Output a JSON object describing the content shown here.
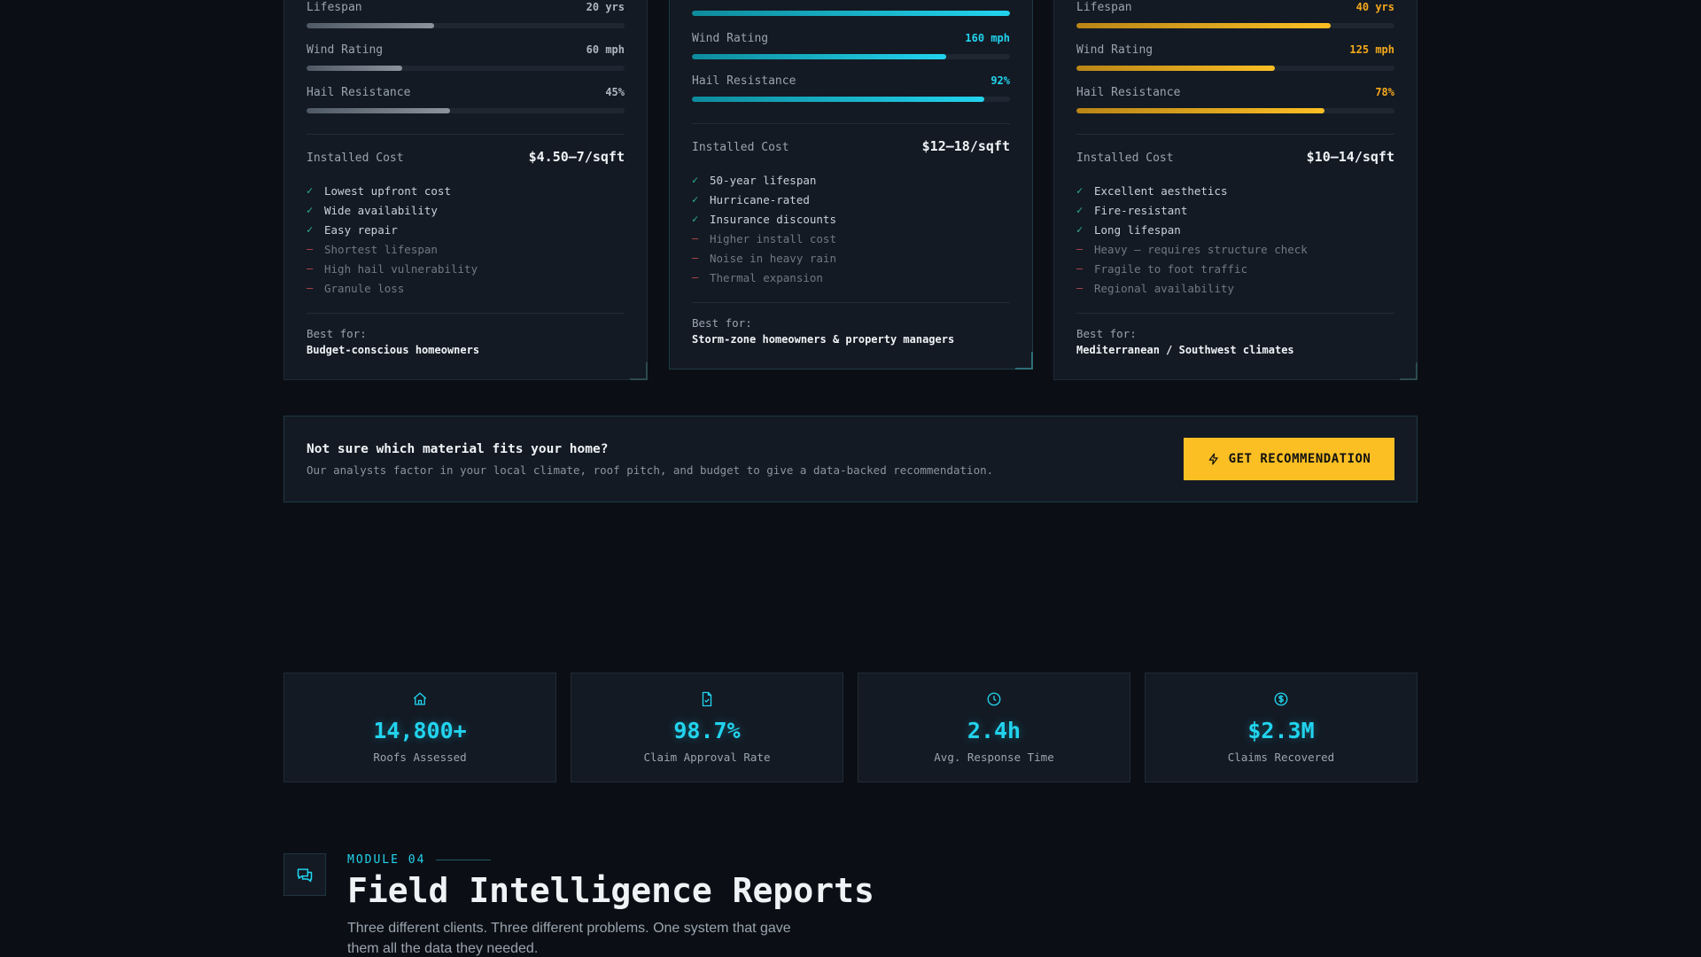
{
  "cards": [
    {
      "metrics": [
        {
          "label": "Lifespan",
          "value": "20 yrs",
          "fill": 0.4
        },
        {
          "label": "Wind Rating",
          "value": "60 mph",
          "fill": 0.3
        },
        {
          "label": "Hail Resistance",
          "value": "45%",
          "fill": 0.45
        }
      ],
      "cost_label": "Installed Cost",
      "cost_value": "$4.50–7/sqft",
      "features": [
        {
          "text": "Lowest upfront cost",
          "type": "pro"
        },
        {
          "text": "Wide availability",
          "type": "pro"
        },
        {
          "text": "Easy repair",
          "type": "pro"
        },
        {
          "text": "Shortest lifespan",
          "type": "con"
        },
        {
          "text": "High hail vulnerability",
          "type": "con"
        },
        {
          "text": "Granule loss",
          "type": "con"
        }
      ],
      "best_for_label": "Best for:",
      "best_for_value": "Budget-conscious homeowners"
    },
    {
      "metrics": [
        {
          "label": "",
          "value": "",
          "fill": 1.0
        },
        {
          "label": "Wind Rating",
          "value": "160 mph",
          "fill": 0.8
        },
        {
          "label": "Hail Resistance",
          "value": "92%",
          "fill": 0.92
        }
      ],
      "cost_label": "Installed Cost",
      "cost_value": "$12–18/sqft",
      "features": [
        {
          "text": "50-year lifespan",
          "type": "pro"
        },
        {
          "text": "Hurricane-rated",
          "type": "pro"
        },
        {
          "text": "Insurance discounts",
          "type": "pro"
        },
        {
          "text": "Higher install cost",
          "type": "con"
        },
        {
          "text": "Noise in heavy rain",
          "type": "con"
        },
        {
          "text": "Thermal expansion",
          "type": "con"
        }
      ],
      "best_for_label": "Best for:",
      "best_for_value": "Storm-zone homeowners & property managers"
    },
    {
      "metrics": [
        {
          "label": "Lifespan",
          "value": "40 yrs",
          "fill": 0.8
        },
        {
          "label": "Wind Rating",
          "value": "125 mph",
          "fill": 0.625
        },
        {
          "label": "Hail Resistance",
          "value": "78%",
          "fill": 0.78
        }
      ],
      "cost_label": "Installed Cost",
      "cost_value": "$10–14/sqft",
      "features": [
        {
          "text": "Excellent aesthetics",
          "type": "pro"
        },
        {
          "text": "Fire-resistant",
          "type": "pro"
        },
        {
          "text": "Long lifespan",
          "type": "pro"
        },
        {
          "text": "Heavy — requires structure check",
          "type": "con"
        },
        {
          "text": "Fragile to foot traffic",
          "type": "con"
        },
        {
          "text": "Regional availability",
          "type": "con"
        }
      ],
      "best_for_label": "Best for:",
      "best_for_value": "Mediterranean / Southwest climates"
    }
  ],
  "marks": {
    "pro": "✓",
    "con": "—"
  },
  "cta": {
    "title": "Not sure which material fits your home?",
    "subtitle": "Our analysts factor in your local climate, roof pitch, and budget to give a data-backed recommendation.",
    "button_label": "GET RECOMMENDATION",
    "button_icon": "lightning-icon"
  },
  "stats": [
    {
      "icon": "house-icon",
      "value": "14,800+",
      "label": "Roofs Assessed"
    },
    {
      "icon": "document-check-icon",
      "value": "98.7%",
      "label": "Claim Approval Rate"
    },
    {
      "icon": "clock-icon",
      "value": "2.4h",
      "label": "Avg. Response Time"
    },
    {
      "icon": "dollar-circle-icon",
      "value": "$2.3M",
      "label": "Claims Recovered"
    }
  ],
  "module": {
    "icon": "chat-bubbles-icon",
    "tag": "MODULE 04",
    "title": "Field Intelligence Reports",
    "description": "Three different clients. Three different problems. One system that gave them all the data they needed."
  },
  "colors": {
    "background": "#0b0f15",
    "card": "#131a24",
    "accent_cyan": "#22d3ee",
    "accent_amber": "#fbbf24",
    "pro_green": "#2fb394",
    "con_red": "#b94a4a"
  }
}
